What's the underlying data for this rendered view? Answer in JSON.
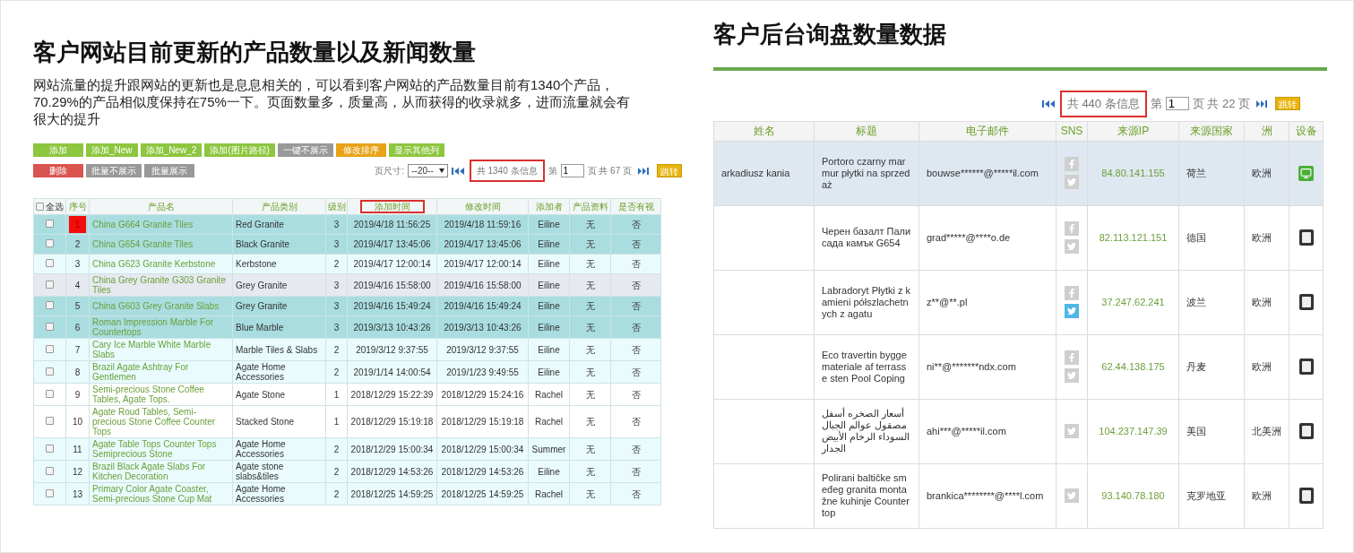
{
  "left": {
    "title": "客户网站目前更新的产品数量以及新闻数量",
    "paragraph": "网站流量的提升跟网站的更新也是息息相关的，可以看到客户网站的产品数量目前有1340个产品，70.29%的产品相似度保持在75%一下。页面数量多，质量高，从而获得的收录就多，进而流量就会有很大的提升",
    "toolbar_rows": [
      [
        {
          "label": "添加",
          "color": "#8dc63f"
        },
        {
          "label": "添加_New",
          "color": "#8dc63f"
        },
        {
          "label": "添加_New_2",
          "color": "#8dc63f"
        },
        {
          "label": "添加(图片路径)",
          "color": "#8dc63f"
        },
        {
          "label": "一键不展示",
          "color": "#999999"
        },
        {
          "label": "修改排序",
          "color": "#e8a317"
        },
        {
          "label": "显示其他列",
          "color": "#8dc63f"
        }
      ],
      [
        {
          "label": "删除",
          "color": "#d9534f"
        },
        {
          "label": "批量不展示",
          "color": "#999999"
        },
        {
          "label": "批量展示",
          "color": "#999999"
        }
      ]
    ],
    "pager": {
      "page_size_label": "页尺寸:",
      "page_size": "--20--",
      "info": "共 1340 条信息",
      "info_boxed": true,
      "page_prefix": "第",
      "page": "1",
      "page_suffix": "页 共 67 页",
      "go": "跳转"
    },
    "table": {
      "select_all": {
        "label": "全选",
        "checked": false
      },
      "columns": [
        {
          "label": "序号",
          "boxed": false
        },
        {
          "label": "产品名",
          "boxed": false
        },
        {
          "label": "产品类别",
          "boxed": false
        },
        {
          "label": "级别",
          "boxed": false
        },
        {
          "label": "添加时间",
          "boxed": true
        },
        {
          "label": "修改时间",
          "boxed": false
        },
        {
          "label": "添加者",
          "boxed": false
        },
        {
          "label": "产品资料",
          "boxed": false
        },
        {
          "label": "是否有视",
          "boxed": false
        }
      ],
      "rows": [
        {
          "kind": "teal",
          "checked": false,
          "flagged": true,
          "serial": "1",
          "name": "China G664 Granite Tiles",
          "category": "Red Granite",
          "grade": "3",
          "added": "2019/4/18 11:56:25",
          "modified": "2019/4/18 11:59:16",
          "author": "Eiline",
          "material": "无",
          "video": "否"
        },
        {
          "kind": "teal",
          "checked": false,
          "flagged": false,
          "serial": "2",
          "name": "China G654 Granite Tiles",
          "category": "Black Granite",
          "grade": "3",
          "added": "2019/4/17 13:45:06",
          "modified": "2019/4/17 13:45:06",
          "author": "Eiline",
          "material": "无",
          "video": "否"
        },
        {
          "kind": "tint",
          "checked": false,
          "flagged": false,
          "serial": "3",
          "name": "China G623 Granite Kerbstone",
          "category": "Kerbstone",
          "grade": "2",
          "added": "2019/4/17 12:00:14",
          "modified": "2019/4/17 12:00:14",
          "author": "Eiline",
          "material": "无",
          "video": "否"
        },
        {
          "kind": "grey",
          "checked": false,
          "flagged": false,
          "serial": "4",
          "name": "China Grey Granite G303 Granite Tiles",
          "category": "Grey Granite",
          "grade": "3",
          "added": "2019/4/16 15:58:00",
          "modified": "2019/4/16 15:58:00",
          "author": "Eiline",
          "material": "无",
          "video": "否"
        },
        {
          "kind": "teal",
          "checked": false,
          "flagged": false,
          "serial": "5",
          "name": "China G603 Grey Granite Slabs",
          "category": "Grey Granite",
          "grade": "3",
          "added": "2019/4/16 15:49:24",
          "modified": "2019/4/16 15:49:24",
          "author": "Eiline",
          "material": "无",
          "video": "否"
        },
        {
          "kind": "teal",
          "checked": false,
          "flagged": false,
          "serial": "6",
          "name": "Roman Impression Marble For Countertops",
          "category": "Blue Marble",
          "grade": "3",
          "added": "2019/3/13 10:43:26",
          "modified": "2019/3/13 10:43:26",
          "author": "Eiline",
          "material": "无",
          "video": "否"
        },
        {
          "kind": "tint",
          "checked": false,
          "flagged": false,
          "serial": "7",
          "name": "Cary Ice Marble White Marble Slabs",
          "category": "Marble Tiles & Slabs",
          "grade": "2",
          "added": "2019/3/12 9:37:55",
          "modified": "2019/3/12 9:37:55",
          "author": "Eiline",
          "material": "无",
          "video": "否"
        },
        {
          "kind": "tint",
          "checked": false,
          "flagged": false,
          "serial": "8",
          "name": "Brazil Agate Ashtray For Gentlemen",
          "category": "Agate Home Accessories",
          "grade": "2",
          "added": "2019/1/14 14:00:54",
          "modified": "2019/1/23 9:49:55",
          "author": "Eiline",
          "material": "无",
          "video": "否"
        },
        {
          "kind": "white",
          "checked": false,
          "flagged": false,
          "serial": "9",
          "name": "Semi-precious Stone Coffee Tables, Agate Tops.",
          "category": "Agate Stone",
          "grade": "1",
          "added": "2018/12/29 15:22:39",
          "modified": "2018/12/29 15:24:16",
          "author": "Rachel",
          "material": "无",
          "video": "否"
        },
        {
          "kind": "white",
          "checked": false,
          "flagged": false,
          "serial": "10",
          "name": "Agate Roud Tables, Semi-precious Stone Coffee Counter Tops",
          "category": "Stacked Stone",
          "grade": "1",
          "added": "2018/12/29 15:19:18",
          "modified": "2018/12/29 15:19:18",
          "author": "Rachel",
          "material": "无",
          "video": "否"
        },
        {
          "kind": "tint",
          "checked": false,
          "flagged": false,
          "serial": "11",
          "name": "Agate Table Tops Counter Tops Semiprecious Stone",
          "category": "Agate Home Accessories",
          "grade": "2",
          "added": "2018/12/29 15:00:34",
          "modified": "2018/12/29 15:00:34",
          "author": "Summer",
          "material": "无",
          "video": "否"
        },
        {
          "kind": "tint",
          "checked": false,
          "flagged": false,
          "serial": "12",
          "name": "Brazil Black Agate Slabs For Kitchen Decoration",
          "category": "Agate stone slabs&tiles",
          "grade": "2",
          "added": "2018/12/29 14:53:26",
          "modified": "2018/12/29 14:53:26",
          "author": "Eiline",
          "material": "无",
          "video": "否"
        },
        {
          "kind": "tint",
          "checked": false,
          "flagged": false,
          "serial": "13",
          "name": "Primary Color Agate Coaster, Semi-precious Stone Cup Mat",
          "category": "Agate Home Accessories",
          "grade": "2",
          "added": "2018/12/25 14:59:25",
          "modified": "2018/12/25 14:59:25",
          "author": "Rachel",
          "material": "无",
          "video": "否"
        }
      ]
    }
  },
  "right": {
    "title": "客户后台询盘数量数据",
    "pager": {
      "info": "共 440 条信息",
      "info_boxed": true,
      "page_prefix": "第",
      "page": "1",
      "page_suffix": "页 共 22 页",
      "go": "跳转"
    },
    "table": {
      "columns": [
        "姓名",
        "标题",
        "电子邮件",
        "SNS",
        "来源IP",
        "来源国家",
        "洲",
        "设备"
      ],
      "rows": [
        {
          "selected": true,
          "name": "arkadiusz kania",
          "subject": "Portoro czarny marmur płytki na sprzedaż",
          "email": "bouwse******@*****il.com",
          "sns": [
            {
              "kind": "facebook",
              "active": false
            },
            {
              "kind": "twitter",
              "active": false
            }
          ],
          "ip": "84.80.141.155",
          "country": "荷兰",
          "continent": "欧洲",
          "device": {
            "kind": "desktop"
          }
        },
        {
          "selected": false,
          "subject": "Черен базалт Палисада камък G654",
          "email": "grad*****@****o.de",
          "sns": [
            {
              "kind": "facebook",
              "active": false
            },
            {
              "kind": "twitter",
              "active": false
            }
          ],
          "ip": "82.113.121.151",
          "country": "德国",
          "continent": "欧洲",
          "device": {
            "kind": "tablet"
          }
        },
        {
          "selected": false,
          "subject": "Labradoryt Płytki z kamieni półszlachetnych z agatu",
          "email": "z**@**.pl",
          "sns": [
            {
              "kind": "facebook",
              "active": false
            },
            {
              "kind": "twitter",
              "active": true
            }
          ],
          "ip": "37.247.62.241",
          "country": "波兰",
          "continent": "欧洲",
          "device": {
            "kind": "tablet"
          }
        },
        {
          "selected": false,
          "subject": "Eco travertin bygge materiale af terrasse sten Pool Coping",
          "email": "ni**@*******ndx.com",
          "sns": [
            {
              "kind": "facebook",
              "active": false
            },
            {
              "kind": "twitter",
              "active": false
            }
          ],
          "ip": "62.44.138.175",
          "country": "丹麦",
          "continent": "欧洲",
          "device": {
            "kind": "tablet"
          }
        },
        {
          "selected": false,
          "subject": "أسعار الصخره أسفل مصقول عوالم الجبال السوداء الرخام الأبيض الجدار",
          "email": "ahi***@*****il.com",
          "sns": [
            {
              "kind": "twitter",
              "active": false
            }
          ],
          "ip": "104.237.147.39",
          "country": "美国",
          "continent": "北美洲",
          "device": {
            "kind": "tablet"
          }
        },
        {
          "selected": false,
          "subject": "Polirani baltičke smeđeg granita montažne kuhinje Countertop",
          "email": "brankica********@****l.com",
          "sns": [
            {
              "kind": "twitter",
              "active": false
            }
          ],
          "ip": "93.140.78.180",
          "country": "克罗地亚",
          "continent": "欧洲",
          "device": {
            "kind": "tablet"
          }
        }
      ]
    }
  }
}
